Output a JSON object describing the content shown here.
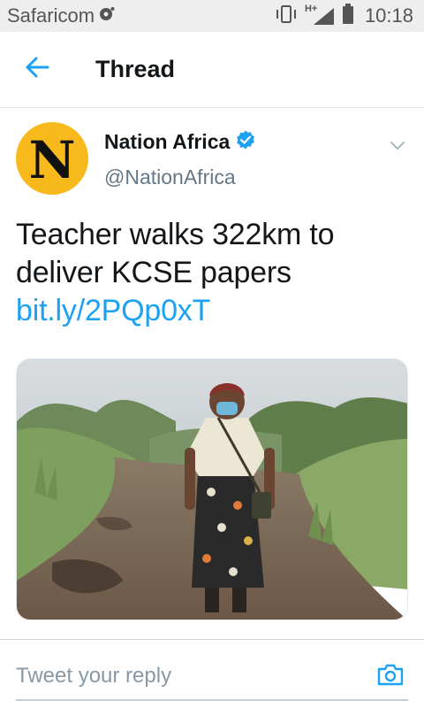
{
  "status_bar": {
    "carrier": "Safaricom",
    "network": "H+",
    "time": "10:18"
  },
  "header": {
    "title": "Thread",
    "back_icon": "arrow-left-icon"
  },
  "tweet": {
    "author": {
      "display_name": "Nation Africa",
      "handle": "@NationAfrica",
      "avatar_letter": "N",
      "verified": true
    },
    "text": "Teacher walks 322km to deliver KCSE papers ",
    "link": "bit.ly/2PQp0xT",
    "media": {
      "type": "photo",
      "alt": "Woman in face mask standing on a muddy dirt path between tall grass"
    }
  },
  "reply": {
    "placeholder": "Tweet your reply"
  },
  "colors": {
    "accent": "#1da1f2",
    "avatar_bg": "#f8b91c",
    "status_bar_bg": "#eeeeee",
    "secondary_text": "#657786"
  }
}
